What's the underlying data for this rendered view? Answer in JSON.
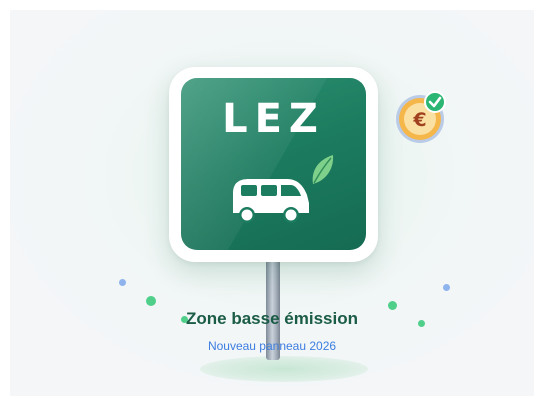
{
  "sign": {
    "text": "LEZ"
  },
  "caption": {
    "title": "Zone basse émission",
    "subtitle": "Nouveau panneau 2026"
  },
  "icons": [
    "leaf-icon",
    "van-icon",
    "euro-coin-icon",
    "check-badge-icon"
  ],
  "colors": {
    "sign_green": "#1c7c5f",
    "title_green": "#1b5c46",
    "subtitle_blue": "#3d7de0",
    "coin_gold": "#f5b64a",
    "check_green": "#2bb673"
  }
}
